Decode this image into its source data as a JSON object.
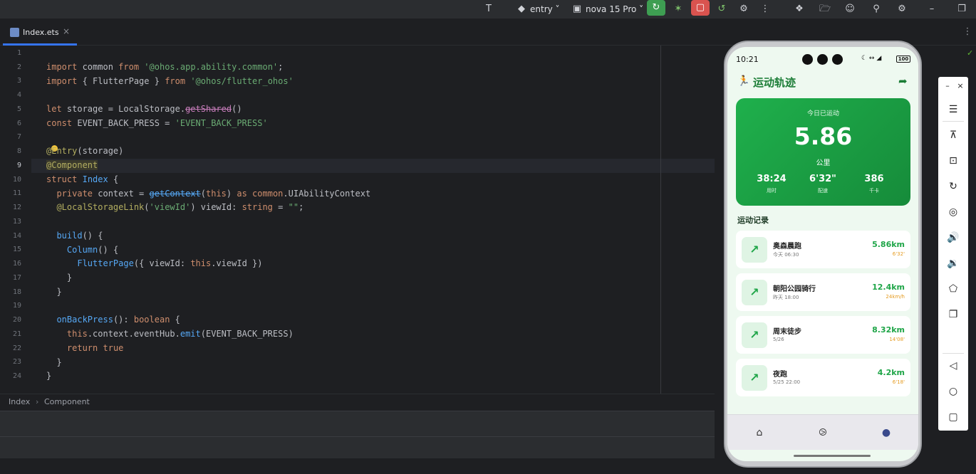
{
  "toolbar": {
    "run_config": "entry",
    "device": "nova 15 Pro"
  },
  "tab": {
    "file_name": "Index.ets"
  },
  "editor": {
    "line_numbers": [
      "1",
      "2",
      "3",
      "4",
      "5",
      "6",
      "7",
      "8",
      "9",
      "10",
      "11",
      "12",
      "13",
      "14",
      "15",
      "16",
      "17",
      "18",
      "19",
      "20",
      "21",
      "22",
      "23",
      "24"
    ]
  },
  "breadcrumb": {
    "items": [
      "Index",
      "Component"
    ]
  },
  "phone": {
    "time": "10:21",
    "battery": "100",
    "app_title": "运动轨迹",
    "hero": {
      "caption": "今日已运动",
      "value": "5.86",
      "unit": "公里",
      "stats": [
        {
          "value": "38:24",
          "label": "用时"
        },
        {
          "value": "6'32\"",
          "label": "配速"
        },
        {
          "value": "386",
          "label": "千卡"
        }
      ]
    },
    "section_title": "运动记录",
    "records": [
      {
        "name": "奥森晨跑",
        "time": "今天 06:30",
        "distance": "5.86km",
        "pace": "6'32'"
      },
      {
        "name": "朝阳公园骑行",
        "time": "昨天 18:00",
        "distance": "12.4km",
        "pace": "24km/h"
      },
      {
        "name": "周末徒步",
        "time": "5/26",
        "distance": "8.32km",
        "pace": "14'08'"
      },
      {
        "name": "夜跑",
        "time": "5/25 22:00",
        "distance": "4.2km",
        "pace": "6'18'"
      }
    ]
  },
  "colors": {
    "accent_green": "#1fa548",
    "dark_green": "#1b7d36",
    "pace_orange": "#e59b20",
    "ide_blue": "#3574f0"
  }
}
